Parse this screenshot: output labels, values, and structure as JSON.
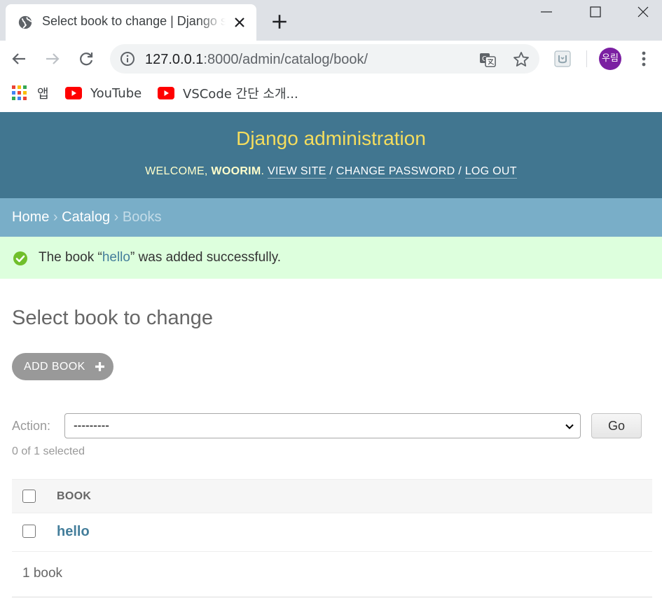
{
  "browser": {
    "tab": {
      "title": "Select book to change | Django site admin"
    },
    "address": {
      "host": "127.0.0.1",
      "path": ":8000/admin/catalog/book/"
    },
    "profile_initials": "우림",
    "bookmarks": [
      {
        "label": "앱",
        "icon": "apps-icon"
      },
      {
        "label": "YouTube",
        "icon": "youtube-icon"
      },
      {
        "label": "VSCode 간단 소개...",
        "icon": "youtube-icon"
      }
    ]
  },
  "admin": {
    "branding": "Django administration",
    "user_tools": {
      "welcome": "WELCOME, ",
      "username": "WOORIM",
      "period": ". ",
      "view_site": "VIEW SITE",
      "change_password": "CHANGE PASSWORD",
      "log_out": "LOG OUT",
      "separator": " / "
    },
    "breadcrumbs": {
      "home": "Home",
      "app": "Catalog",
      "current": "Books",
      "separator": " › "
    },
    "message": {
      "prefix": "The book “",
      "link": "hello",
      "suffix": "” was added successfully."
    },
    "title": "Select book to change",
    "add_button": "ADD BOOK",
    "actions": {
      "label": "Action:",
      "selected_option": "---------",
      "go_label": "Go",
      "selected_count": "0 of 1 selected"
    },
    "table": {
      "column_header": "BOOK",
      "rows": [
        {
          "title": "hello"
        }
      ]
    },
    "paginator": "1 book"
  },
  "colors": {
    "header_bg": "#417690",
    "branding": "#f5dd5d",
    "breadcrumbs_bg": "#79aec8",
    "success_bg": "#dddfdd",
    "link": "#447e9b",
    "profile_bg": "#7b1fa2"
  }
}
